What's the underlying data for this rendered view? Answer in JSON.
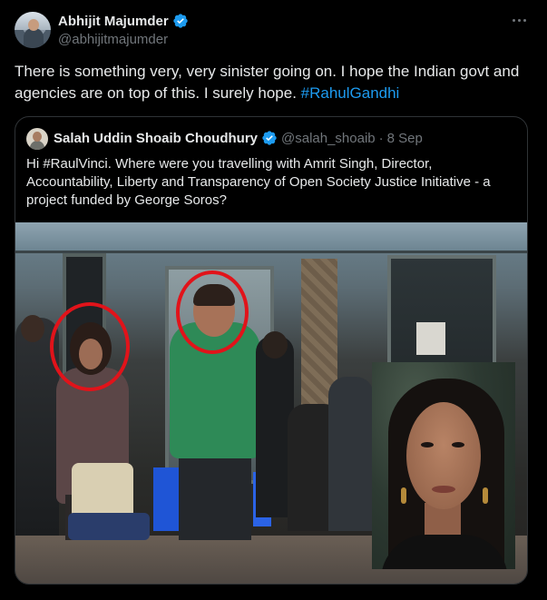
{
  "tweet": {
    "display_name": "Abhijit Majumder",
    "handle": "@abhijitmajumder",
    "text": "There is something very, very sinister going on. I hope the Indian govt and agencies are on top of this. I surely hope. ",
    "hashtag": "#RahulGandhi"
  },
  "quote": {
    "display_name": "Salah Uddin Shoaib Choudhury",
    "handle": "@salah_shoaib",
    "separator": "·",
    "date": "8 Sep",
    "text": "Hi #RaulVinci. Where were you travelling with Amrit Singh, Director, Accountability, Liberty and Transparency of Open Society Justice Initiative - a project funded by George Soros?"
  },
  "colors": {
    "background": "#000000",
    "text": "#e7e9ea",
    "muted": "#71767b",
    "link": "#1d9bf0",
    "verified": "#1d9bf0",
    "circle": "#e1131a"
  },
  "icons": [
    "verified-badge-icon",
    "more-options-icon"
  ]
}
